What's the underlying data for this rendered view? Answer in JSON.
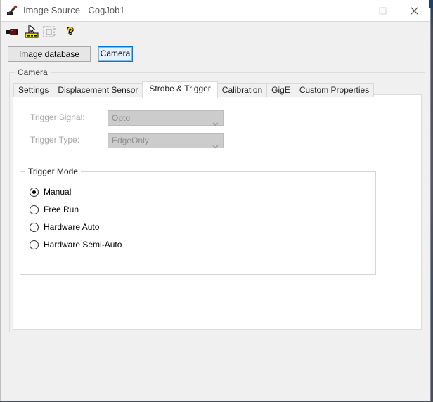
{
  "window": {
    "title": "Image Source - CogJob1"
  },
  "toolbar": {
    "icons": [
      {
        "name": "acquire-camera-icon",
        "disabled": false
      },
      {
        "name": "pointer-ruler-setup-icon",
        "disabled": false
      },
      {
        "name": "live-display-icon",
        "disabled": true
      },
      {
        "name": "help-icon",
        "disabled": false
      }
    ],
    "help_glyph": "?"
  },
  "source_buttons": {
    "image_database_label": "Image database",
    "camera_label": "Camera"
  },
  "camera_group": {
    "label": "Camera",
    "tabs": [
      {
        "label": "Settings",
        "active": false
      },
      {
        "label": "Displacement Sensor",
        "active": false
      },
      {
        "label": "Strobe & Trigger",
        "active": true
      },
      {
        "label": "Calibration",
        "active": false
      },
      {
        "label": "GigE",
        "active": false
      },
      {
        "label": "Custom Properties",
        "active": false
      }
    ]
  },
  "strobe_trigger_panel": {
    "trigger_signal": {
      "label": "Trigger Signal:",
      "value": "Opto",
      "disabled": true
    },
    "trigger_type": {
      "label": "Trigger Type:",
      "value": "EdgeOnly",
      "disabled": true
    },
    "trigger_mode": {
      "label": "Trigger Mode",
      "options": [
        {
          "label": "Manual",
          "selected": true
        },
        {
          "label": "Free Run",
          "selected": false
        },
        {
          "label": "Hardware Auto",
          "selected": false
        },
        {
          "label": "Hardware Semi-Auto",
          "selected": false
        }
      ]
    }
  },
  "colors": {
    "accent_blue": "#0078d7",
    "camera_button_bg": "#e5f1fb",
    "dialog_bg": "#f0f0f0",
    "titlebar_bg": "#ffffff",
    "disabled_field_bg": "#cccccc",
    "disabled_text": "#a6a6a6",
    "toolbar_yellow": "#ffdf00"
  }
}
